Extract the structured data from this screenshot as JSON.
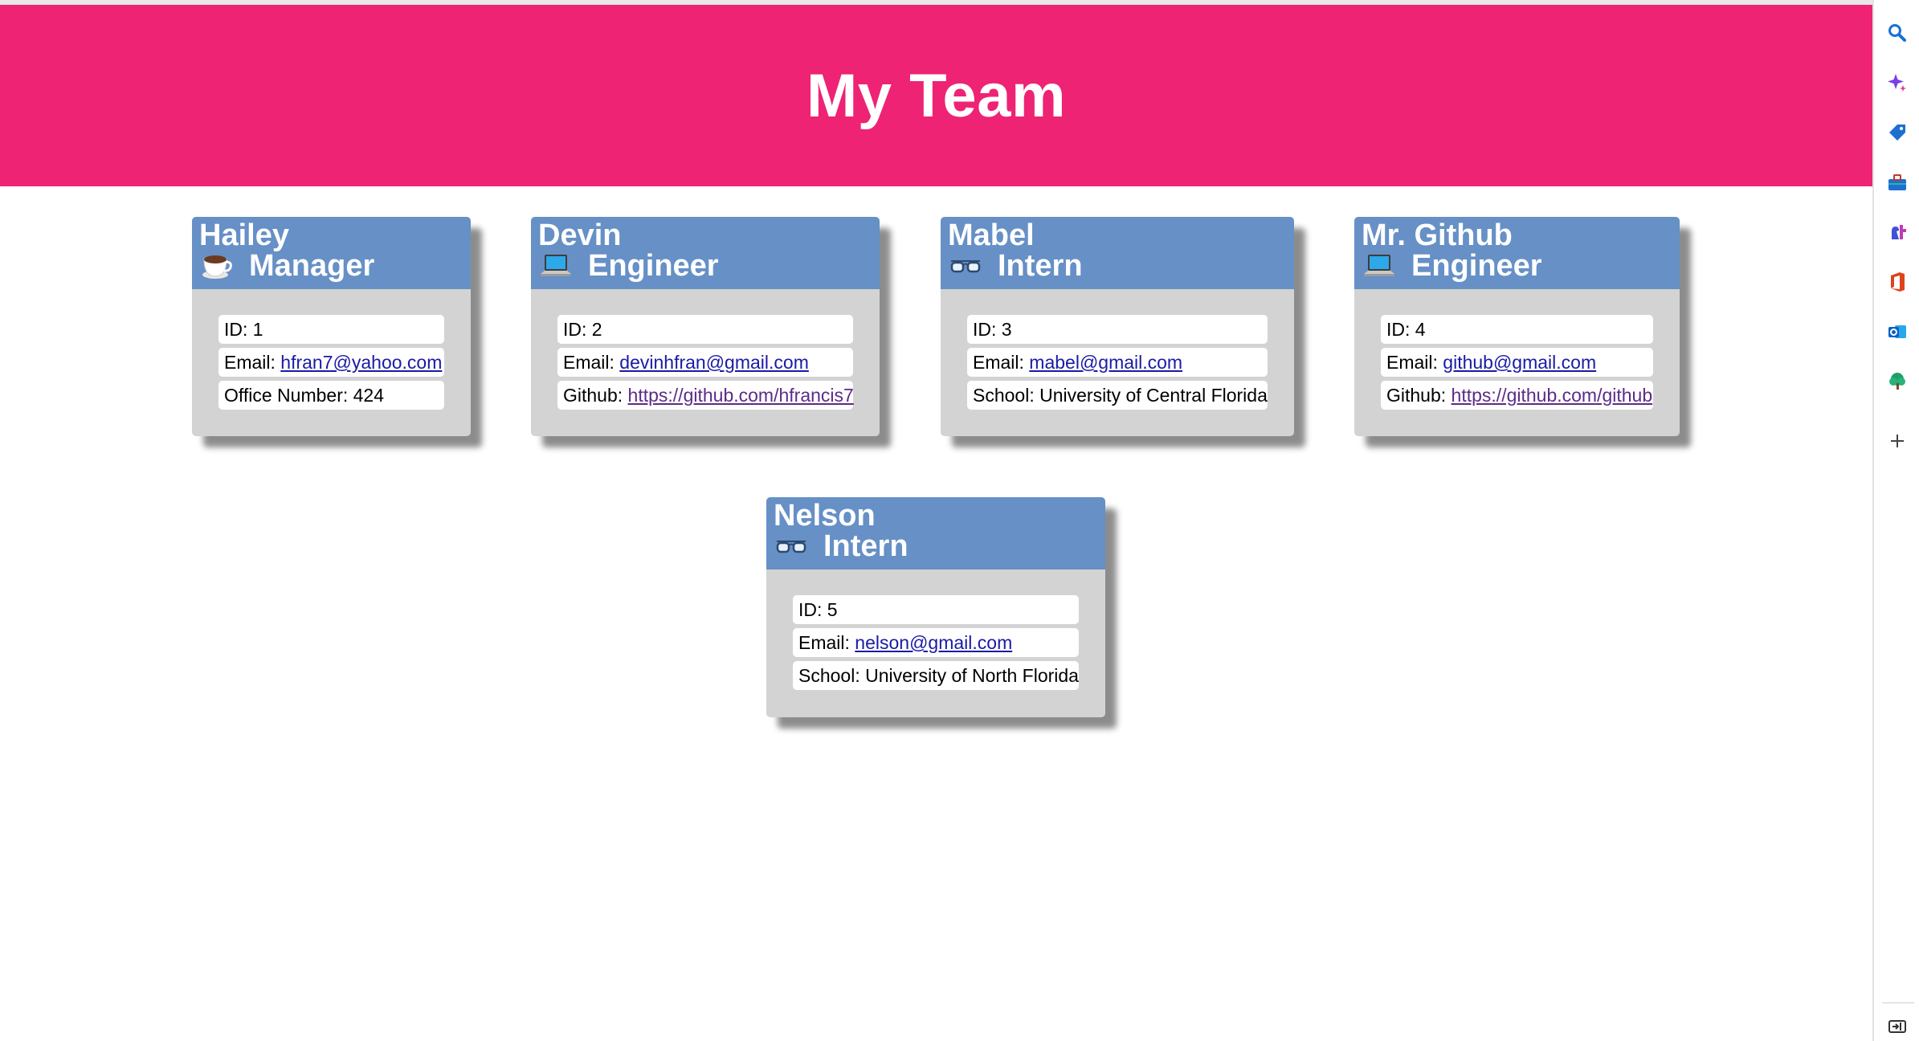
{
  "page": {
    "title": "My Team"
  },
  "cards": [
    {
      "name": "Hailey",
      "role": "Manager",
      "icon": "coffee-icon",
      "id_label": "ID: 1",
      "email_label": "Email: ",
      "email": "hfran7@yahoo.com",
      "extra_label": "Office Number: 424",
      "extra_link": ""
    },
    {
      "name": "Devin",
      "role": "Engineer",
      "icon": "laptop-icon",
      "id_label": "ID: 2",
      "email_label": "Email: ",
      "email": "devinhfran@gmail.com",
      "extra_label": "Github: ",
      "extra_link": "https://github.com/hfrancis7"
    },
    {
      "name": "Mabel",
      "role": "Intern",
      "icon": "glasses-icon",
      "id_label": "ID: 3",
      "email_label": "Email: ",
      "email": "mabel@gmail.com",
      "extra_label": "School: University of Central Florida",
      "extra_link": ""
    },
    {
      "name": "Mr. Github",
      "role": "Engineer",
      "icon": "laptop-icon",
      "id_label": "ID: 4",
      "email_label": "Email: ",
      "email": "github@gmail.com",
      "extra_label": "Github: ",
      "extra_link": "https://github.com/github"
    },
    {
      "name": "Nelson",
      "role": "Intern",
      "icon": "glasses-icon",
      "id_label": "ID: 5",
      "email_label": "Email: ",
      "email": "nelson@gmail.com",
      "extra_label": "School: University of North Florida",
      "extra_link": ""
    }
  ],
  "sidebar": {
    "icons": [
      "search-icon",
      "copilot-sparkle-icon",
      "shopping-tag-icon",
      "tools-briefcase-icon",
      "games-icon",
      "office-icon",
      "outlook-icon",
      "tree-icon",
      "add-icon",
      "sidebar-toggle-icon"
    ]
  },
  "colors": {
    "header": "#ee2374",
    "card_head": "#6690c6",
    "card_body": "#d3d3d3",
    "link": "#1a1aa6",
    "visited_link": "#5b2b86"
  }
}
